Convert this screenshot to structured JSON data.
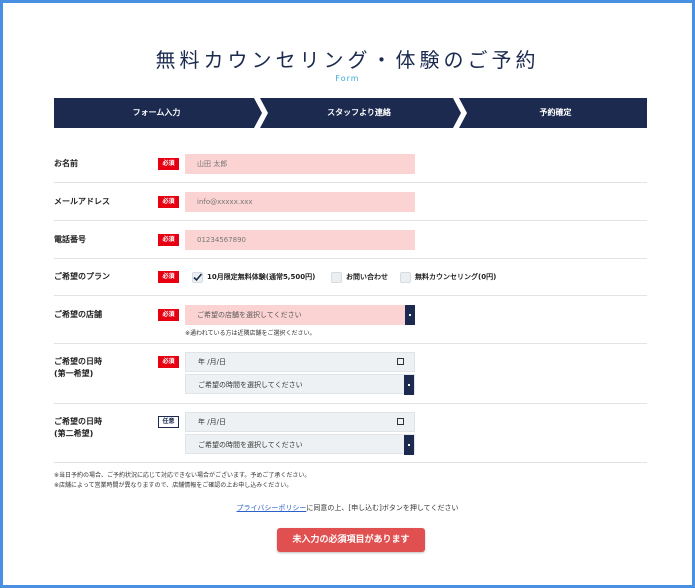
{
  "header": {
    "title": "無料カウンセリング・体験のご予約",
    "subtitle": "Form"
  },
  "steps": [
    "フォーム入力",
    "スタッフより連絡",
    "予約確定"
  ],
  "badges": {
    "required": "必須",
    "optional": "任意"
  },
  "fields": {
    "name": {
      "label": "お名前",
      "placeholder": "山田 太郎"
    },
    "email": {
      "label": "メールアドレス",
      "placeholder": "info@xxxxx.xxx"
    },
    "phone": {
      "label": "電話番号",
      "placeholder": "01234567890"
    },
    "plan": {
      "label": "ご希望のプラン",
      "options": [
        {
          "label": "10月限定無料体験(通常5,500円)",
          "checked": true
        },
        {
          "label": "お問い合わせ",
          "checked": false
        },
        {
          "label": "無料カウンセリング(0円)",
          "checked": false
        }
      ]
    },
    "store": {
      "label": "ご希望の店舗",
      "placeholder": "ご希望の店舗を選択してください",
      "note": "※通われている方は近隣店舗をご選択ください。"
    },
    "date1": {
      "label_line1": "ご希望の日時",
      "label_line2": "(第一希望)",
      "date_placeholder": "年 /月/日",
      "time_placeholder": "ご希望の時間を選択してください"
    },
    "date2": {
      "label_line1": "ご希望の日時",
      "label_line2": "(第二希望)",
      "date_placeholder": "年 /月/日",
      "time_placeholder": "ご希望の時間を選択してください"
    }
  },
  "notes": [
    "※当日予約の場合、ご予約状況に応じて対応できない場合がございます。予めご了承ください。",
    "※店舗によって営業時間が異なりますので、店舗情報をご確認の上お申し込みください。"
  ],
  "privacy": {
    "link": "プライバシーポリシー",
    "text": "に同意の上、[申し込む]ボタンを押してください"
  },
  "submit": {
    "label": "未入力の必須項目があります"
  },
  "colors": {
    "navy": "#1b2a4e",
    "required": "#e60012",
    "input_bg": "#fcd3d3",
    "submit": "#e05050",
    "accent": "#3aa7d8"
  }
}
